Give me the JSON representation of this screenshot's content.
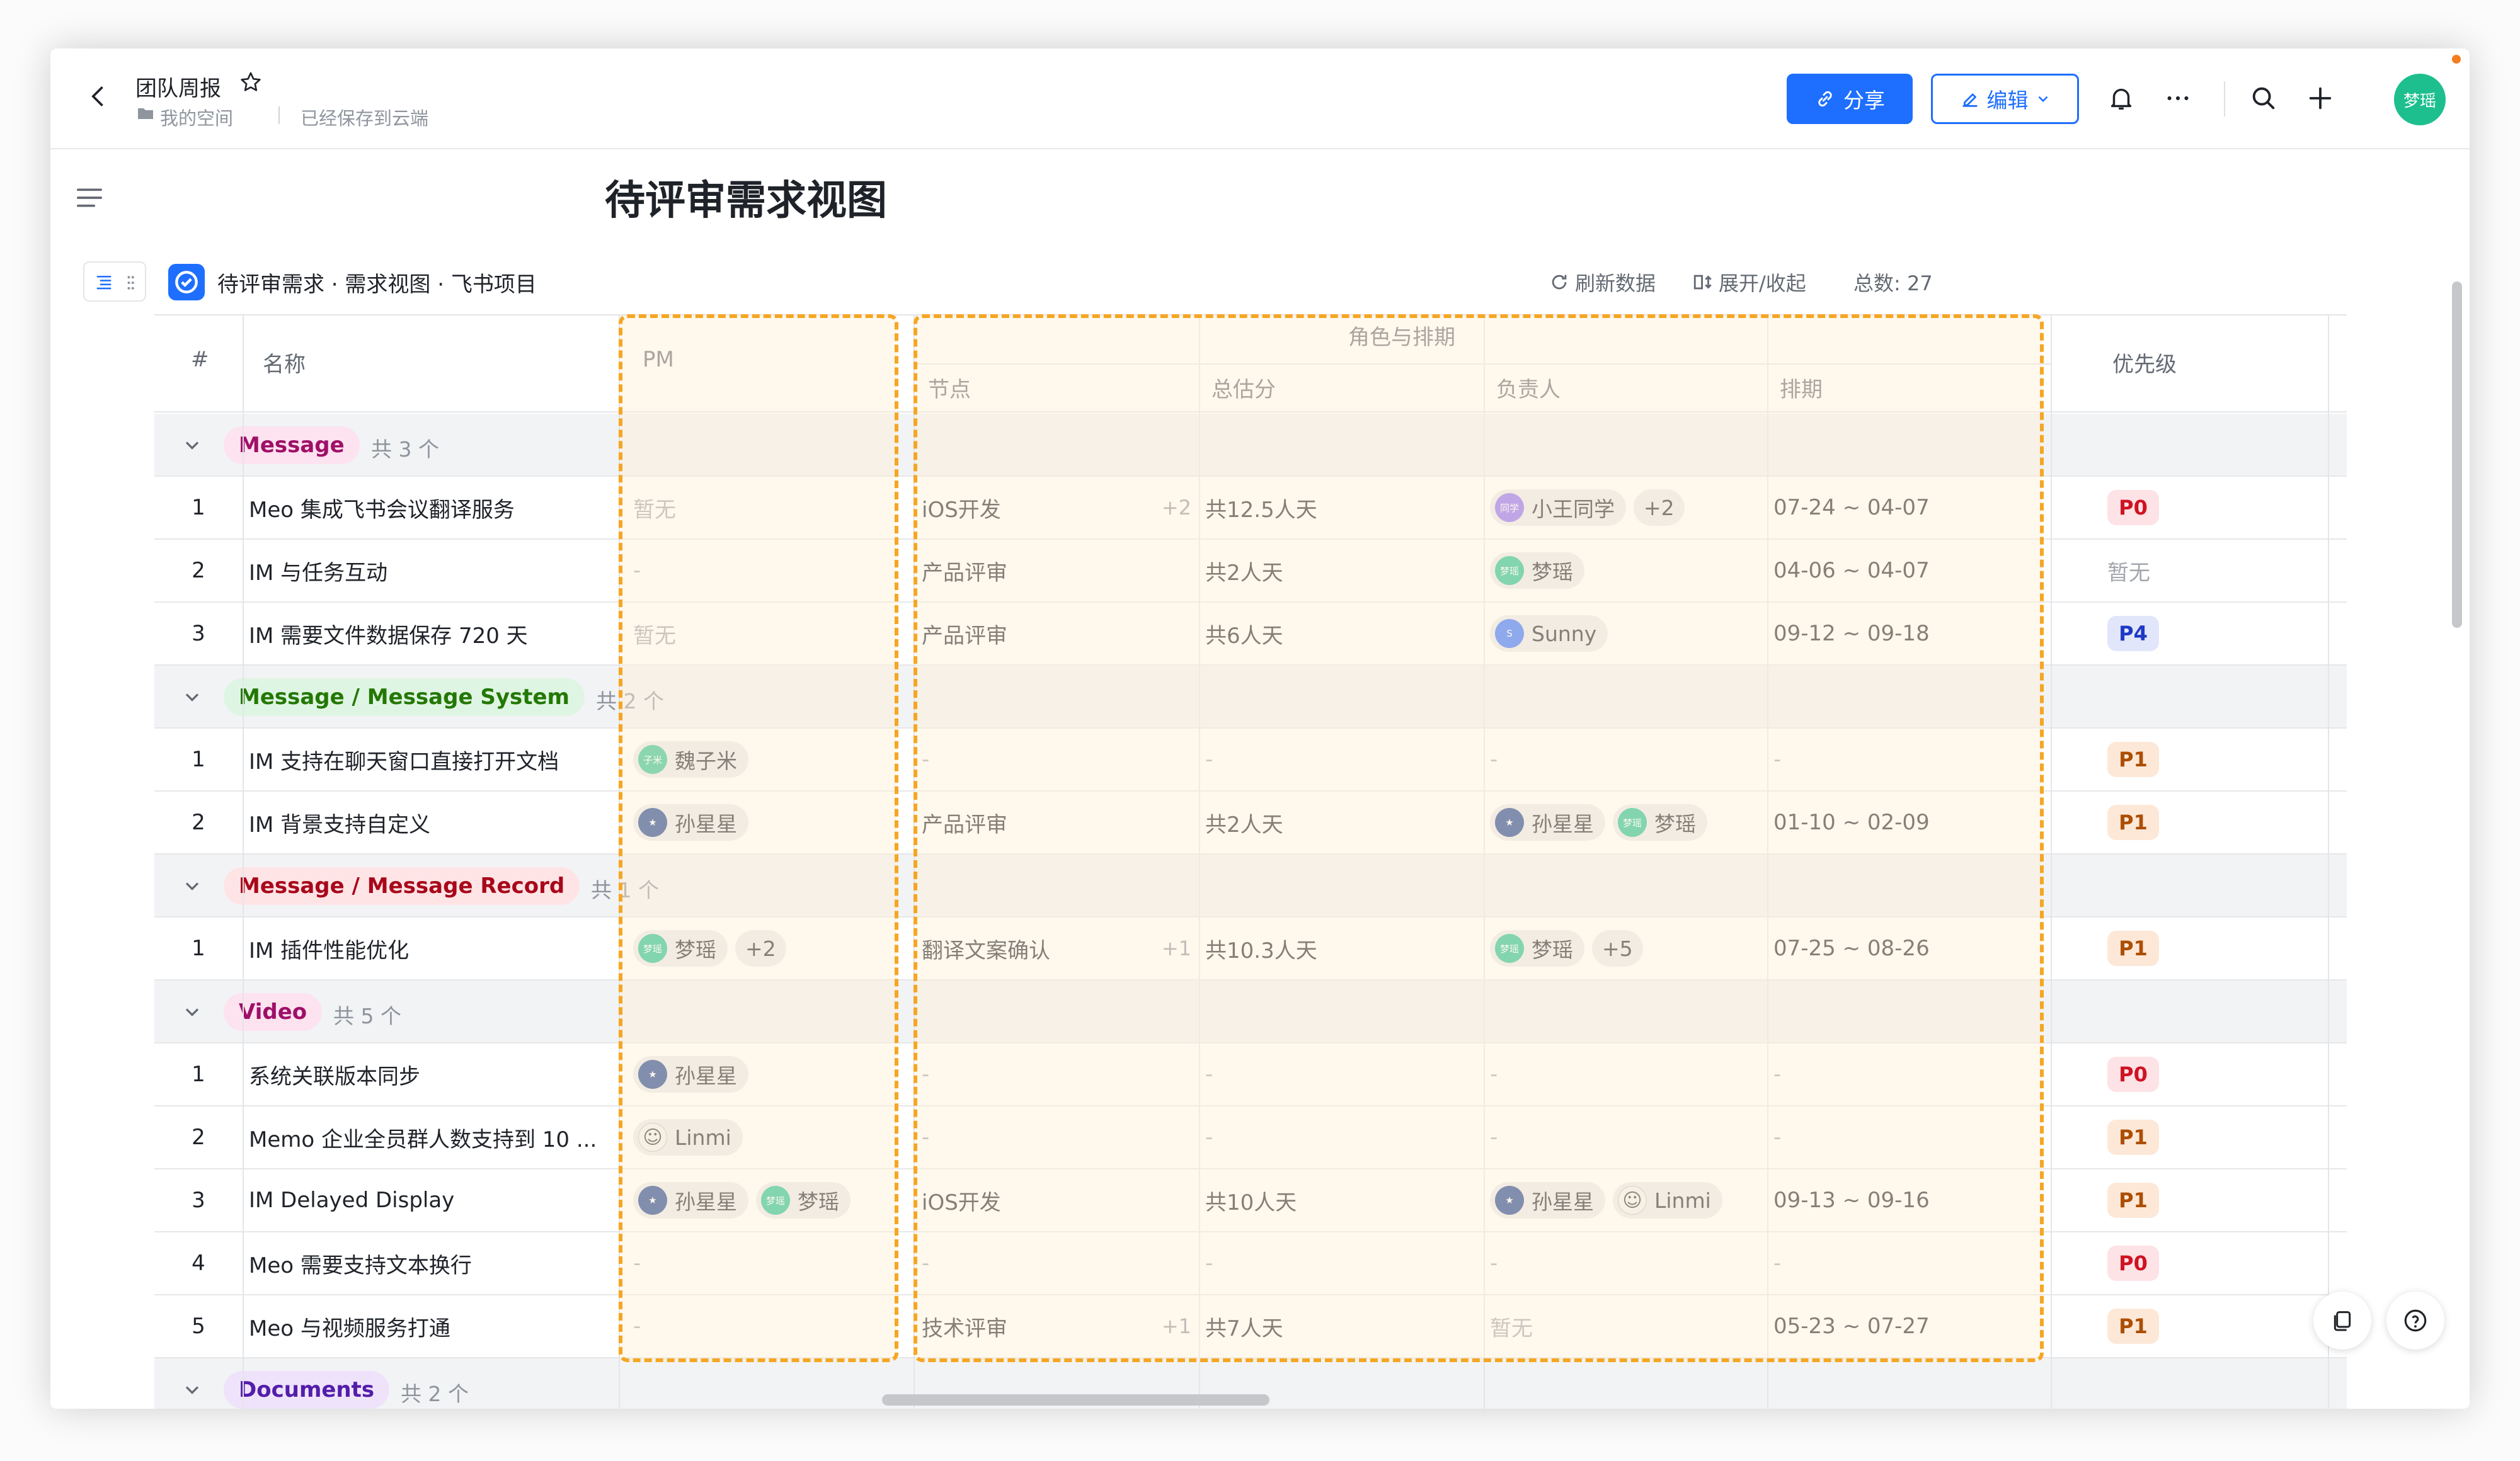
{
  "header": {
    "doc_title": "团队周报",
    "space_label": "我的空间",
    "saved_status": "已经保存到云端",
    "share_label": "分享",
    "edit_label": "编辑",
    "user_avatar": "梦瑶"
  },
  "page_title": "待评审需求视图",
  "block": {
    "title": "待评审需求 · 需求视图 · 飞书项目",
    "refresh_label": "刷新数据",
    "expand_label": "展开/收起",
    "total_label": "总数: 27"
  },
  "columns": {
    "index": "#",
    "name": "名称",
    "pm": "PM",
    "group_header": "角色与排期",
    "node": "节点",
    "estimate": "总估分",
    "owner": "负责人",
    "schedule": "排期",
    "priority": "优先级"
  },
  "groups": [
    {
      "label": "Message",
      "count": "共 3 个",
      "tag_bg": "#fde2ef",
      "tag_fg": "#9e1068",
      "rows": [
        {
          "no": "1",
          "name": "Meo 集成飞书会议翻译服务",
          "pm_text": "暂无",
          "pm": [],
          "node": "iOS开发",
          "node_extra": "+2",
          "estimate": "共12.5人天",
          "owner": [
            {
              "name": "小王同学",
              "color": "#8c6bf2",
              "txt": "同学"
            }
          ],
          "owner_more": "+2",
          "schedule": "07-24 ~ 04-07",
          "priority": "P0"
        },
        {
          "no": "2",
          "name": "IM 与任务互动",
          "pm_text": "-",
          "pm": [],
          "node": "产品评审",
          "node_extra": "",
          "estimate": "共2人天",
          "owner": [
            {
              "name": "梦瑶",
              "color": "#1dbf8e",
              "txt": "梦瑶"
            }
          ],
          "owner_more": "",
          "schedule": "04-06 ~ 04-07",
          "priority": "暂无"
        },
        {
          "no": "3",
          "name": "IM 需要文件数据保存 720 天",
          "pm_text": "暂无",
          "pm": [],
          "node": "产品评审",
          "node_extra": "",
          "estimate": "共6人天",
          "owner": [
            {
              "name": "Sunny",
              "color": "#3370ff",
              "txt": "S"
            }
          ],
          "owner_more": "",
          "schedule": "09-12 ~ 09-18",
          "priority": "P4"
        }
      ]
    },
    {
      "label": "Message / Message System",
      "count": "共 2 个",
      "tag_bg": "#dff5e3",
      "tag_fg": "#237804",
      "rows": [
        {
          "no": "1",
          "name": "IM 支持在聊天窗口直接打开文档",
          "pm_text": "",
          "pm": [
            {
              "name": "魏子米",
              "color": "#2fc28f",
              "txt": "子米"
            }
          ],
          "pm_more": "",
          "node": "-",
          "node_extra": "",
          "estimate": "-",
          "owner": [],
          "owner_text": "-",
          "owner_more": "",
          "schedule": "-",
          "priority": "P1"
        },
        {
          "no": "2",
          "name": "IM 背景支持自定义",
          "pm_text": "",
          "pm": [
            {
              "name": "孙星星",
              "color": "#1d3f8a",
              "txt": "★"
            }
          ],
          "pm_more": "",
          "node": "产品评审",
          "node_extra": "",
          "estimate": "共2人天",
          "owner": [
            {
              "name": "孙星星",
              "color": "#1d3f8a",
              "txt": "★"
            },
            {
              "name": "梦瑶",
              "color": "#1dbf8e",
              "txt": "梦瑶"
            }
          ],
          "owner_more": "",
          "schedule": "01-10 ~ 02-09",
          "priority": "P1"
        }
      ]
    },
    {
      "label": "Message / Message Record",
      "count": "共 1 个",
      "tag_bg": "#ffe4e6",
      "tag_fg": "#a8071a",
      "rows": [
        {
          "no": "1",
          "name": "IM 插件性能优化",
          "pm_text": "",
          "pm": [
            {
              "name": "梦瑶",
              "color": "#1dbf8e",
              "txt": "梦瑶"
            }
          ],
          "pm_more": "+2",
          "node": "翻译文案确认",
          "node_extra": "+1",
          "estimate": "共10.3人天",
          "owner": [
            {
              "name": "梦瑶",
              "color": "#1dbf8e",
              "txt": "梦瑶"
            }
          ],
          "owner_more": "+5",
          "schedule": "07-25 ~ 08-26",
          "priority": "P1"
        }
      ]
    },
    {
      "label": "Video",
      "count": "共 5 个",
      "tag_bg": "#fde2ef",
      "tag_fg": "#9e1068",
      "rows": [
        {
          "no": "1",
          "name": "系统关联版本同步",
          "pm_text": "",
          "pm": [
            {
              "name": "孙星星",
              "color": "#1d3f8a",
              "txt": "★"
            }
          ],
          "pm_more": "",
          "node": "-",
          "node_extra": "",
          "estimate": "-",
          "owner": [],
          "owner_text": "-",
          "owner_more": "",
          "schedule": "-",
          "priority": "P0"
        },
        {
          "no": "2",
          "name": "Memo 企业全员群人数支持到 10 ...",
          "pm_text": "",
          "pm": [
            {
              "name": "Linmi",
              "color": "#f0f0f0",
              "txt": "☺"
            }
          ],
          "pm_more": "",
          "node": "-",
          "node_extra": "",
          "estimate": "-",
          "owner": [],
          "owner_text": "-",
          "owner_more": "",
          "schedule": "-",
          "priority": "P1"
        },
        {
          "no": "3",
          "name": "IM Delayed Display",
          "pm_text": "",
          "pm": [
            {
              "name": "孙星星",
              "color": "#1d3f8a",
              "txt": "★"
            },
            {
              "name": "梦瑶",
              "color": "#1dbf8e",
              "txt": "梦瑶"
            }
          ],
          "pm_more": "",
          "node": "iOS开发",
          "node_extra": "",
          "estimate": "共10人天",
          "owner": [
            {
              "name": "孙星星",
              "color": "#1d3f8a",
              "txt": "★"
            },
            {
              "name": "Linmi",
              "color": "#f0f0f0",
              "txt": "☺"
            }
          ],
          "owner_more": "",
          "schedule": "09-13 ~ 09-16",
          "priority": "P1"
        },
        {
          "no": "4",
          "name": "Meo 需要支持文本换行",
          "pm_text": "-",
          "pm": [],
          "node": "-",
          "node_extra": "",
          "estimate": "-",
          "owner": [],
          "owner_text": "-",
          "owner_more": "",
          "schedule": "-",
          "priority": "P0"
        },
        {
          "no": "5",
          "name": "Meo 与视频服务打通",
          "pm_text": "-",
          "pm": [],
          "node": "技术评审",
          "node_extra": "+1",
          "estimate": "共7人天",
          "owner": [],
          "owner_text": "暂无",
          "owner_more": "",
          "schedule": "05-23 ~ 07-27",
          "priority": "P1"
        }
      ]
    },
    {
      "label": "Documents",
      "count": "共 2 个",
      "tag_bg": "#efe3fb",
      "tag_fg": "#531dab",
      "rows": []
    }
  ],
  "priority_colors": {
    "P0": {
      "bg": "#fde2e6",
      "fg": "#cf1322"
    },
    "P1": {
      "bg": "#fde8d8",
      "fg": "#ad4e00"
    },
    "P4": {
      "bg": "#e1e6fb",
      "fg": "#1d39c4"
    }
  },
  "colors": {
    "accent": "#1e6fff",
    "highlight_dash": "#f5a623",
    "avatar_green": "#1dbf8e"
  }
}
